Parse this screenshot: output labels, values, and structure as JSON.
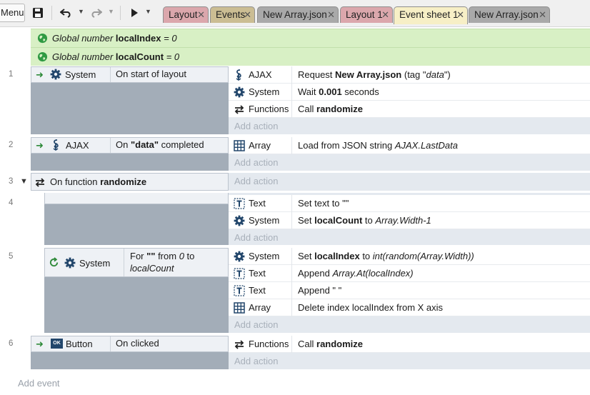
{
  "toolbar": {
    "menu_label": "Menu",
    "tabs": [
      {
        "label": "Layout"
      },
      {
        "label": "Events"
      },
      {
        "label": "New Array.json"
      },
      {
        "label": "Layout 1"
      },
      {
        "label": "Event sheet 1"
      },
      {
        "label": "New Array.json"
      }
    ],
    "close_glyph": "✕"
  },
  "globals": [
    {
      "prefix": "Global number",
      "name": "localIndex",
      "value": "= 0"
    },
    {
      "prefix": "Global number",
      "name": "localCount",
      "value": "= 0"
    }
  ],
  "events": {
    "e1": {
      "line": "1",
      "object": "System",
      "condition": "On start of layout",
      "actions": [
        {
          "object": "AJAX",
          "pre": "Request ",
          "bold": "New Array.json",
          "post": " (tag \"",
          "italic": "data",
          "end": "\")"
        },
        {
          "object": "System",
          "pre": "Wait ",
          "bold": "0.001",
          "post": " seconds"
        },
        {
          "object": "Functions",
          "pre": "Call ",
          "bold": "randomize"
        }
      ]
    },
    "e2": {
      "line": "2",
      "object": "AJAX",
      "cond_pre": "On ",
      "cond_bold": "\"data\"",
      "cond_post": " completed",
      "actions": [
        {
          "object": "Array",
          "pre": "Load from JSON string ",
          "italic": "AJAX.LastData"
        }
      ]
    },
    "e3": {
      "line": "3",
      "pre": "On function ",
      "bold": "randomize"
    },
    "e4": {
      "line": "4",
      "actions": [
        {
          "object": "Text",
          "pre": "Set text to \"\""
        },
        {
          "object": "System",
          "pre": "Set ",
          "bold": "localCount",
          "post": " to ",
          "italic": "Array.Width-1"
        }
      ]
    },
    "e5": {
      "line": "5",
      "object": "System",
      "cond_line1_pre": "For ",
      "cond_line1_bold": "\"\"",
      "cond_line1_mid": " from ",
      "cond_line1_italic": "0",
      "cond_line1_post": " to",
      "cond_line2_italic": "localCount",
      "actions": [
        {
          "object": "System",
          "pre": "Set ",
          "bold": "localIndex",
          "post": " to ",
          "italic": "int(random(Array.Width))"
        },
        {
          "object": "Text",
          "pre": "Append ",
          "italic": "Array.At(localIndex)"
        },
        {
          "object": "Text",
          "pre": "Append \" \""
        },
        {
          "object": "Array",
          "pre": "Delete index localIndex from X axis"
        }
      ]
    },
    "e6": {
      "line": "6",
      "object": "Button",
      "condition": "On clicked",
      "actions": [
        {
          "object": "Functions",
          "pre": "Call ",
          "bold": "randomize"
        }
      ]
    }
  },
  "add_action_label": "Add action",
  "add_event_label": "Add event",
  "icon_text": {
    "button": "OK"
  },
  "colors": {
    "global_var_bg": "#d8f0c5",
    "condition_block": "#a3adb8",
    "action_area": "#e4e9ef",
    "gear": "#22466b",
    "trigger_arrow": "#2f8a3a"
  }
}
